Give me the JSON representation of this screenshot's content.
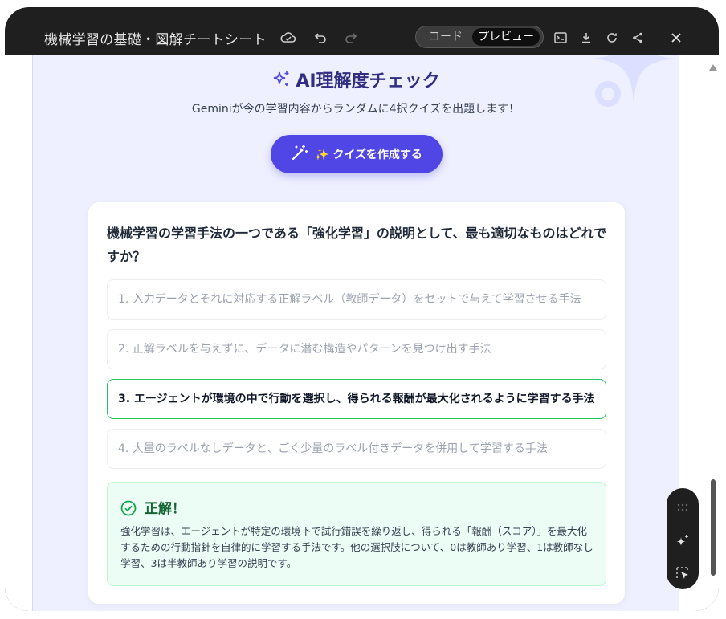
{
  "window": {
    "title": "機械学習の基礎・図解チートシート",
    "toggle": {
      "code_label": "コード",
      "preview_label": "プレビュー"
    }
  },
  "icons": {
    "cloud": "cloud-icon",
    "undo": "undo-icon",
    "redo": "redo-icon",
    "terminal": "terminal-icon",
    "download": "download-icon",
    "refresh": "refresh-icon",
    "share": "share-icon",
    "close": "close-icon"
  },
  "quiz_section": {
    "heading": "AI理解度チェック",
    "subtitle": "Geminiが今の学習内容からランダムに4択クイズを出題します！",
    "create_button": "✨ クイズを作成する"
  },
  "quiz": {
    "question": "機械学習の学習手法の一つである「強化学習」の説明として、最も適切なものはどれですか？",
    "options": [
      "1. 入力データとそれに対応する正解ラベル（教師データ）をセットで与えて学習させる手法",
      "2. 正解ラベルを与えずに、データに潜む構造やパターンを見つけ出す手法",
      "3. エージェントが環境の中で行動を選択し、得られる報酬が最大化されるように学習する手法",
      "4. 大量のラベルなしデータと、ごく少量のラベル付きデータを併用して学習する手法"
    ],
    "selected_index": 2,
    "result": {
      "title": "正解！",
      "explanation": "強化学習は、エージェントが特定の環境下で試行錯誤を繰り返し、得られる「報酬（スコア）」を最大化するための行動指針を自律的に学習する手法です。他の選択肢について、0は教師あり学習、1は教師なし学習、3は半教師あり学習の説明です。"
    }
  },
  "colors": {
    "accent": "#4f46e5",
    "heading": "#312e81",
    "panel_bg": "#eef0ff",
    "correct_border": "#22c55e",
    "result_bg": "#ecfdf5"
  }
}
